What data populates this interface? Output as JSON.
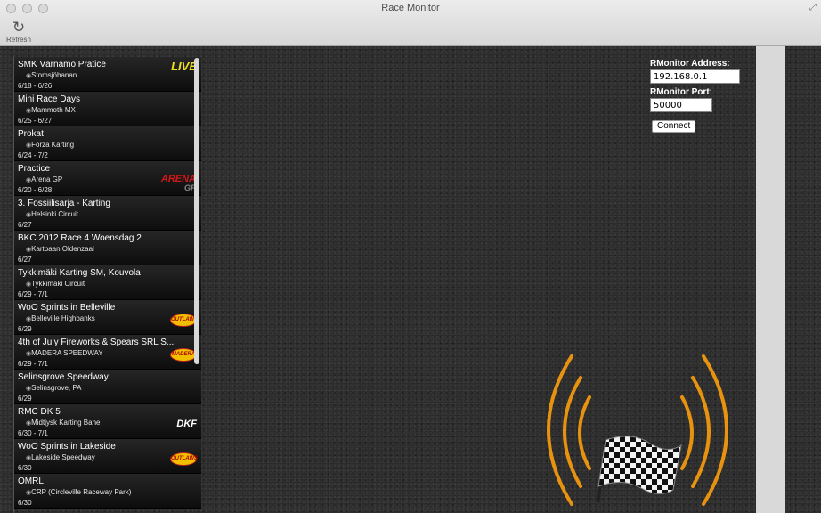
{
  "window": {
    "title": "Race Monitor"
  },
  "toolbar": {
    "refresh_label": "Refresh",
    "refresh_icon": "refresh-icon"
  },
  "races": [
    {
      "name": "SMK Värnamo Pratice",
      "venue": "Stomsjöbanan",
      "dates": "6/18 - 6/26",
      "badge": "LIVE"
    },
    {
      "name": "Mini Race Days",
      "venue": "Mammoth MX",
      "dates": "6/25 - 6/27"
    },
    {
      "name": "Prokat",
      "venue": "Forza Karting",
      "dates": "6/24 - 7/2"
    },
    {
      "name": "Practice",
      "venue": "Arena GP",
      "dates": "6/20 - 6/28",
      "badge": "ARENA",
      "badge_sub": "GP"
    },
    {
      "name": "3. Fossiilisarja - Karting",
      "venue": "Helsinki Circuit",
      "dates": "6/27"
    },
    {
      "name": "BKC 2012 Race 4 Woensdag 2",
      "venue": "Kartbaan Oldenzaal",
      "dates": "6/27"
    },
    {
      "name": "Tykkimäki Karting SM, Kouvola",
      "venue": "Tykkimäki Circuit",
      "dates": "6/29 - 7/1"
    },
    {
      "name": "WoO Sprints in Belleville",
      "venue": "Belleville Highbanks",
      "dates": "6/29",
      "badge": "OUTLAWS"
    },
    {
      "name": "4th of July Fireworks & Spears SRL S...",
      "venue": "MADERA SPEEDWAY",
      "dates": "6/29 - 7/1",
      "badge": "MADERA"
    },
    {
      "name": "Selinsgrove Speedway",
      "venue": "Selinsgrove, PA",
      "dates": "6/29"
    },
    {
      "name": "RMC DK 5",
      "venue": "Midtjysk Karting Bane",
      "dates": "6/30 - 7/1",
      "badge": "DKF"
    },
    {
      "name": "WoO Sprints in Lakeside",
      "venue": "Lakeside Speedway",
      "dates": "6/30",
      "badge": "OUTLAWS"
    },
    {
      "name": "OMRL",
      "venue": "CRP (Circleville Raceway Park)",
      "dates": "6/30"
    }
  ],
  "connection": {
    "address_label": "RMonitor Address:",
    "address_value": "192.168.0.1",
    "port_label": "RMonitor Port:",
    "port_value": "50000",
    "connect_label": "Connect"
  },
  "colors": {
    "live": "#f0e020",
    "signal_arcs": "#e8930f",
    "stripe": "#d9d9d9"
  }
}
